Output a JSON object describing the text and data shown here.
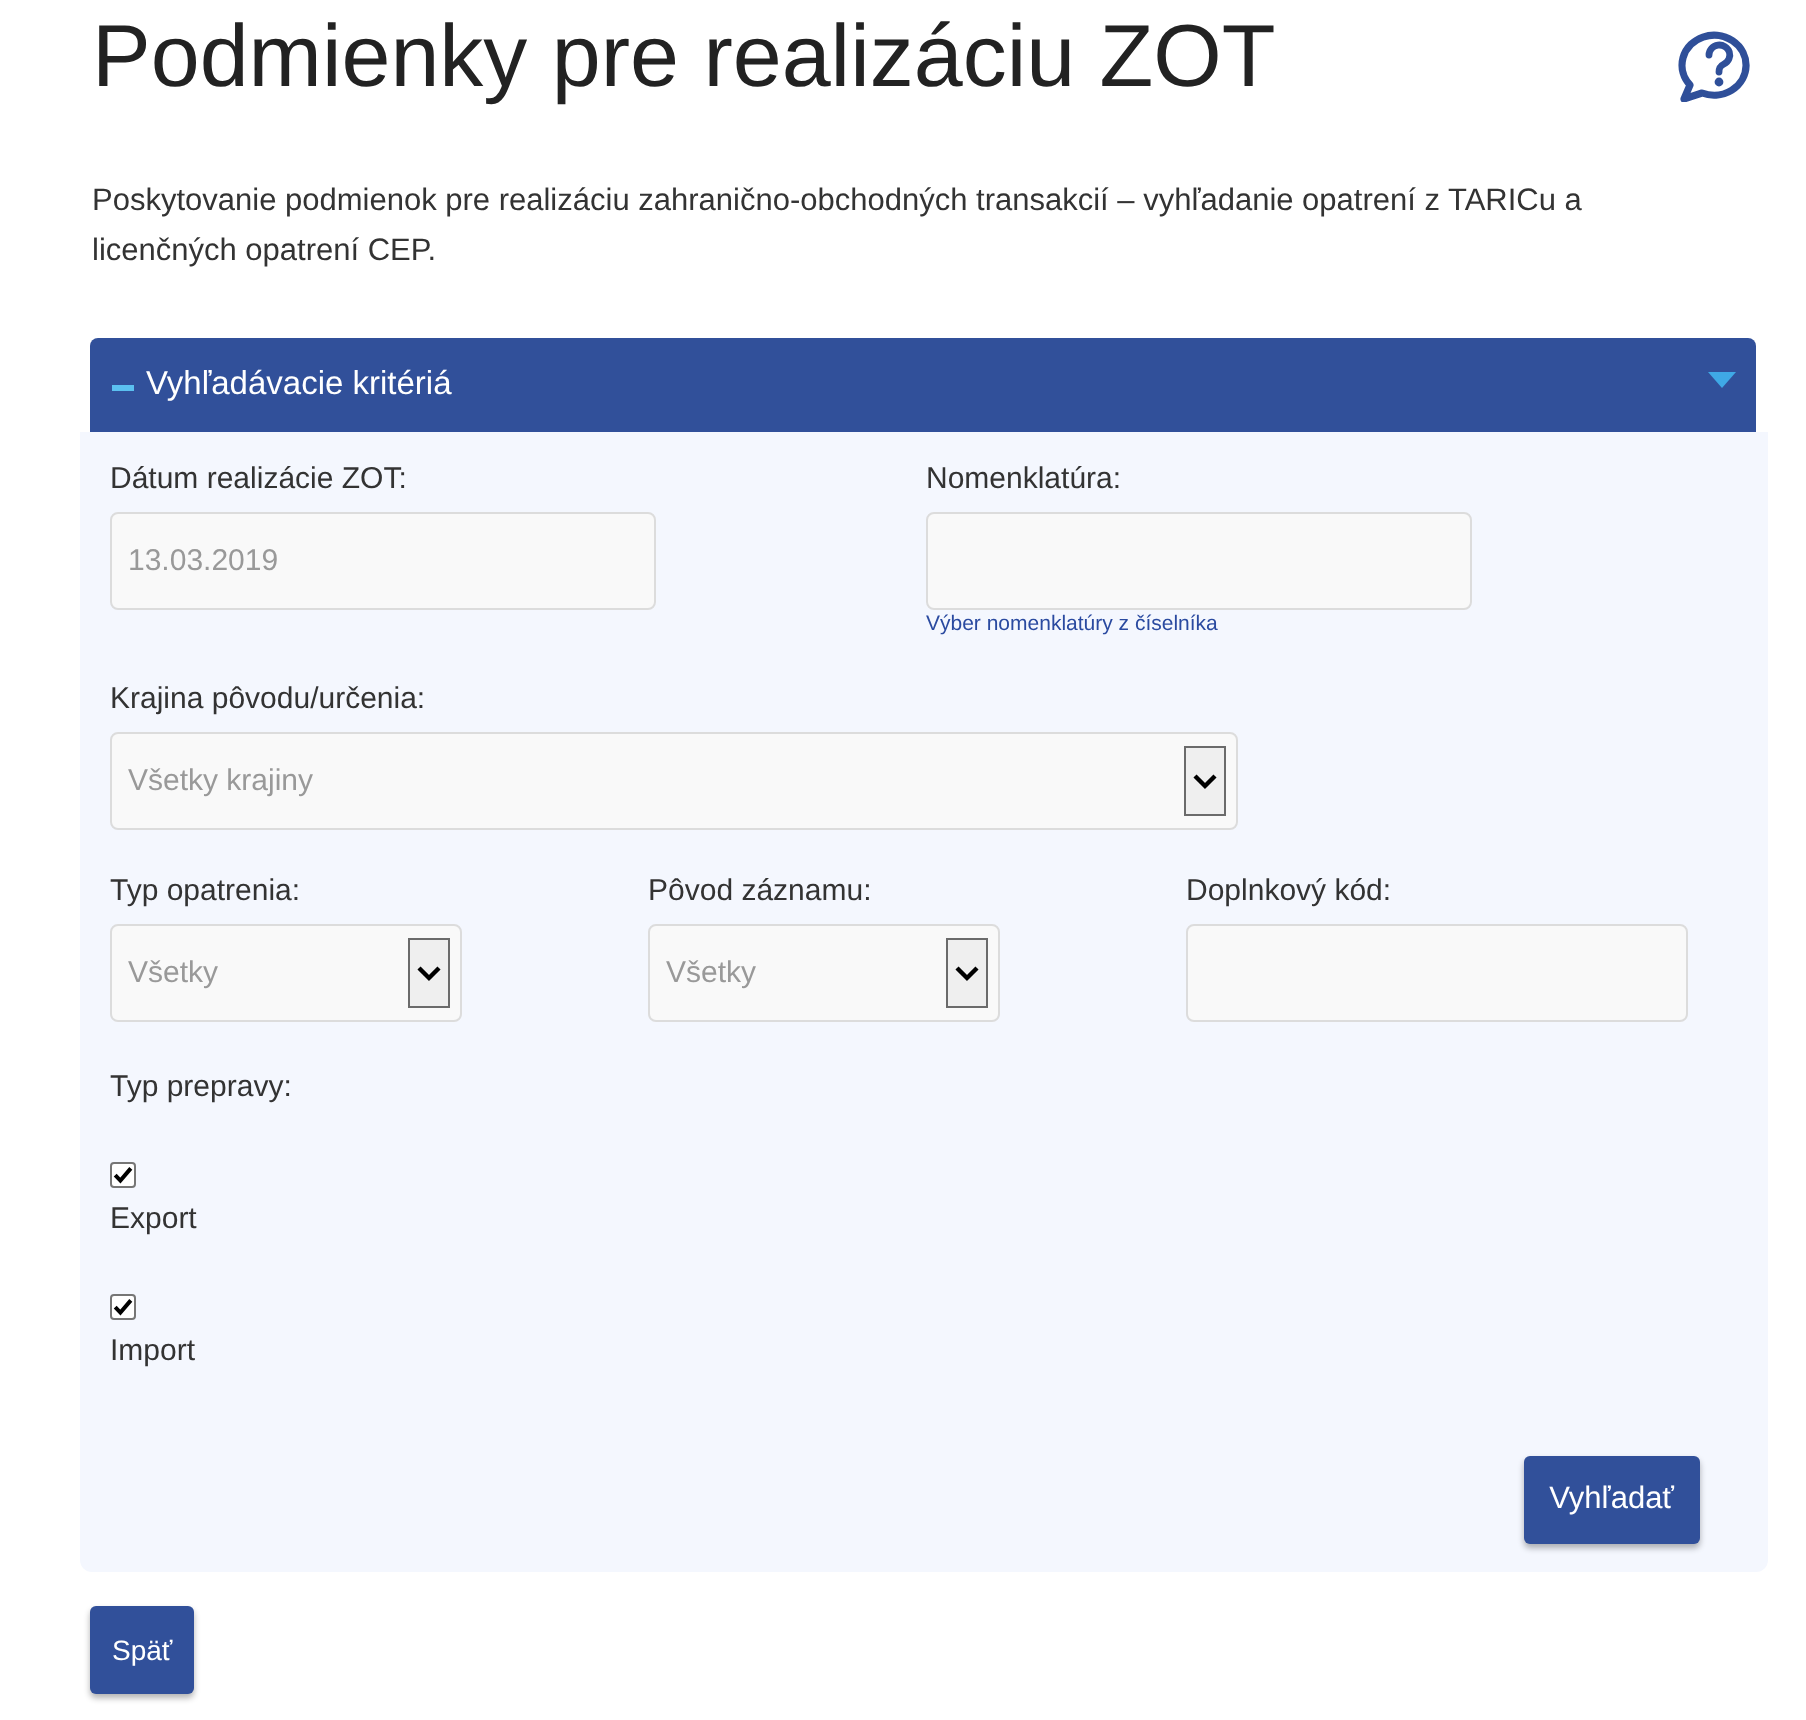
{
  "page": {
    "title": "Podmienky pre realizáciu ZOT",
    "description": "Poskytovanie podmienok pre realizáciu zahranično-obchodných transakcií – vyhľadanie opatrení z TARICu a licenčných opatrení CEP."
  },
  "panel": {
    "title": "Vyhľadávacie kritériá",
    "expanded": true,
    "rows": [
      [
        {
          "kind": "text",
          "label": "Dátum realizácie ZOT:",
          "value": "13.03.2019"
        },
        {
          "kind": "text",
          "label": "Nomenklatúra:",
          "link": "Výber nomenklatúry z číselníka"
        }
      ],
      [
        {
          "kind": "select",
          "label": "Krajina pôvodu/určenia:",
          "value": "Všetky krajiny"
        }
      ],
      [
        {
          "kind": "select",
          "label": "Typ opatrenia:",
          "value": "Všetky"
        },
        {
          "kind": "select",
          "label": "Pôvod záznamu:",
          "value": "Všetky"
        },
        {
          "kind": "text",
          "label": "Doplnkový kód:"
        }
      ]
    ],
    "transport": {
      "label": "Typ prepravy:",
      "options": [
        {
          "label": "Export",
          "checked": true
        },
        {
          "label": "Import",
          "checked": true
        }
      ]
    },
    "search_button": "Vyhľadať"
  },
  "back_button": "Späť"
}
